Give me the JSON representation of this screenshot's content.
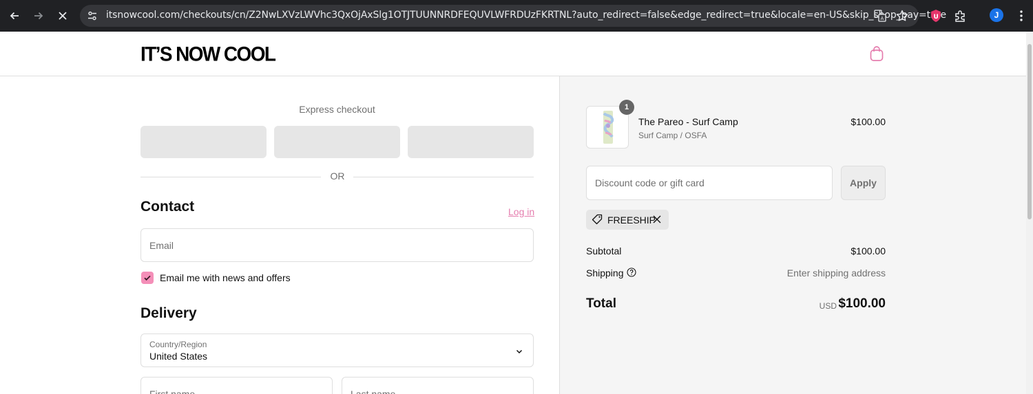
{
  "browser": {
    "url": "itsnowcool.com/checkouts/cn/Z2NwLXVzLWVhc3QxOjAxSlg1OTJTUUNNRDFEQUVLWFRDUzFKRTNL?auto_redirect=false&edge_redirect=true&locale=en-US&skip_shop_pay=true",
    "profile_initial": "J"
  },
  "header": {
    "logo": "IT’S NOW COOL"
  },
  "express": {
    "title": "Express checkout",
    "or": "OR"
  },
  "contact": {
    "heading": "Contact",
    "login": "Log in",
    "email_placeholder": "Email",
    "newsletter_label": "Email me with news and offers",
    "newsletter_checked": true
  },
  "delivery": {
    "heading": "Delivery",
    "country_label": "Country/Region",
    "country_value": "United States",
    "first_name_placeholder": "First name",
    "last_name_placeholder": "Last name"
  },
  "summary": {
    "product": {
      "quantity": "1",
      "name": "The Pareo - Surf Camp",
      "variant": "Surf Camp / OSFA",
      "price": "$100.00"
    },
    "discount_placeholder": "Discount code or gift card",
    "apply_label": "Apply",
    "applied_code": "FREESHIP",
    "subtotal_label": "Subtotal",
    "subtotal_value": "$100.00",
    "shipping_label": "Shipping",
    "shipping_value": "Enter shipping address",
    "total_label": "Total",
    "total_currency": "USD",
    "total_value": "$100.00"
  },
  "colors": {
    "accent": "#e57dae",
    "checkbox": "#f48fb8",
    "chrome": "#202124"
  }
}
